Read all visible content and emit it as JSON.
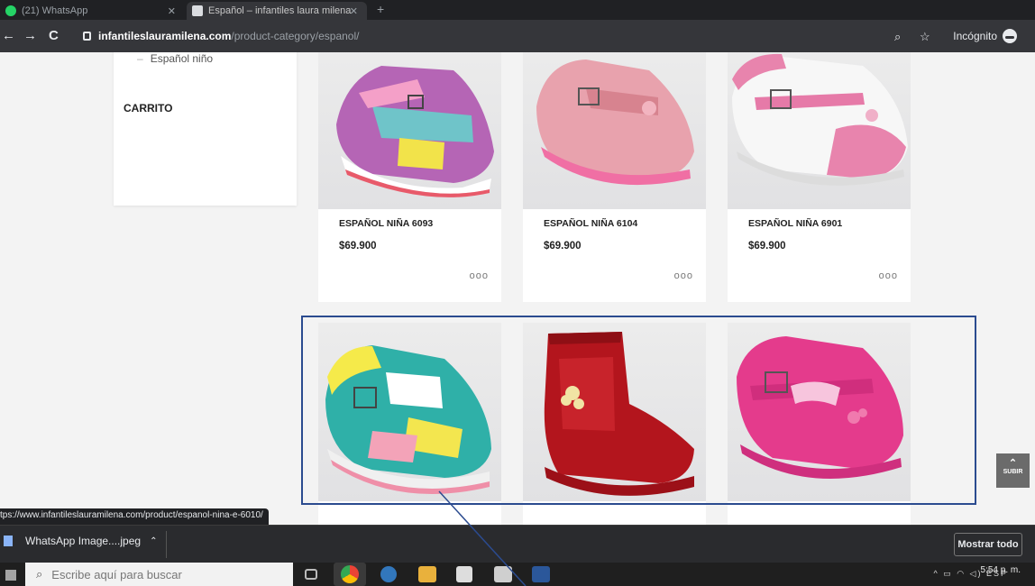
{
  "browser": {
    "tabs": [
      {
        "label": "(21) WhatsApp",
        "close": "✕"
      },
      {
        "label": "Español – infantiles laura milena",
        "close": "✕"
      }
    ],
    "new_tab": "+",
    "url_host": "infantileslauramilena.com",
    "url_path": "/product-category/espanol/",
    "incognito_label": "Incógnito"
  },
  "sidebar": {
    "sub_item": "Español niño",
    "cart_title": "CARRITO"
  },
  "products": [
    {
      "name": "ESPAÑOL NIÑA 6093",
      "price": "$69.900"
    },
    {
      "name": "ESPAÑOL NIÑA 6104",
      "price": "$69.900"
    },
    {
      "name": "ESPAÑOL NIÑA 6901",
      "price": "$69.900"
    }
  ],
  "more_glyph": "ooo",
  "scroll_top": {
    "arrow": "⌃",
    "label": "SUBIR"
  },
  "status_url": "tps://www.infantileslauramilena.com/product/espanol-nina-e-6010/",
  "download_bar": {
    "item": "WhatsApp Image....jpeg",
    "show_all": "Mostrar todo"
  },
  "taskbar": {
    "search_placeholder": "Escribe aquí para buscar",
    "lang": "ESP",
    "time": "5:54 p. m."
  },
  "colors": {
    "highlight_border": "#2b4b8f",
    "chrome_dark": "#35363a"
  }
}
